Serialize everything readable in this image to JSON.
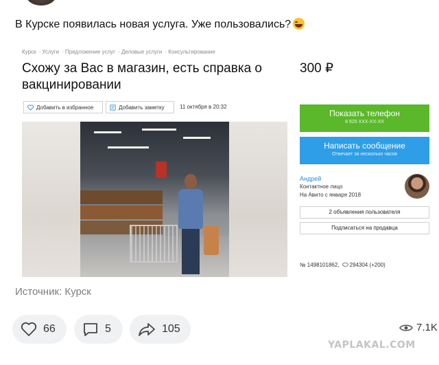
{
  "post": {
    "text": "В Курске появилась новая услуга. Уже пользовались?",
    "emoji": "laughing-emoji",
    "source": "Источник: Курск"
  },
  "listing": {
    "breadcrumbs": [
      "Курск",
      "Услуги",
      "Предложение услуг",
      "Деловые услуги",
      "Консультирование"
    ],
    "title": "Схожу за Вас в магазин, есть справка о вакцинировании",
    "price": "300 ₽",
    "favorite_label": "Добавить в избранное",
    "note_label": "Добавить заметку",
    "date": "11 октября в 20:32",
    "call_button": {
      "label": "Показать телефон",
      "sub": "8 925 XXX-XX-XX",
      "color": "#5ab82a"
    },
    "message_button": {
      "label": "Написать сообщение",
      "sub": "Отвечает за несколько часов",
      "color": "#2e9ee8"
    },
    "seller": {
      "name": "Андрей",
      "role": "Контактное лицо",
      "since": "На Авито с января 2018"
    },
    "seller_ads_label": "2 объявления пользователя",
    "subscribe_label": "Подписаться на продавца",
    "ad_number": "№ 1498101862,",
    "views": "294304 (+200)"
  },
  "actions": {
    "likes": "66",
    "comments": "5",
    "shares": "105",
    "views": "7.1K"
  },
  "watermark": "YAPLAKAL.COM"
}
